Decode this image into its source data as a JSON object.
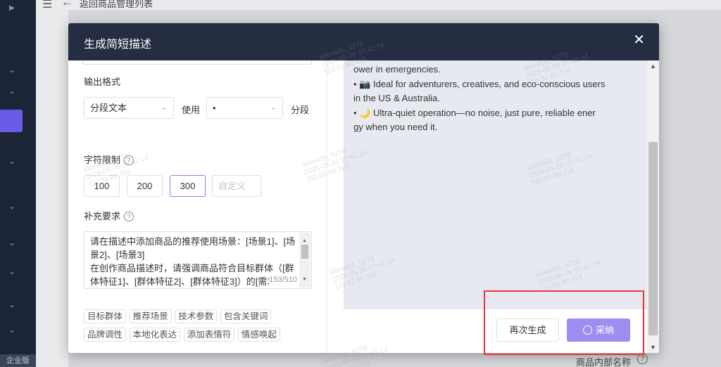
{
  "background": {
    "back_label": "返回商品管理列表",
    "edition_label": "企业版",
    "right_field_label": "商品内部名称",
    "help_glyph": "?"
  },
  "modal": {
    "title": "生成简短描述",
    "close_glyph": "✕"
  },
  "form": {
    "output_format": {
      "label": "输出格式",
      "format_select_value": "分段文本",
      "use_text": "使用",
      "separator_select_value": "•",
      "segment_text": "分段"
    },
    "char_limit": {
      "label": "字符限制",
      "options": [
        "100",
        "200",
        "300"
      ],
      "selected": "300",
      "custom_placeholder": "自定义"
    },
    "extra_requirements": {
      "label": "补充要求",
      "lines": [
        "请在描述中添加商品的推荐使用场景：[场景1]、[场",
        "景2]、[场景3]",
        "在创作商品描述时，请强调商品符合目标群体（[群",
        "体特征1]、[群体特征2]、[群体特征3]）的[需求"
      ],
      "counter": "153/510"
    },
    "tags": [
      "目标群体",
      "推荐场景",
      "技术参数",
      "包含关键词",
      "品牌调性",
      "本地化表达",
      "添加表情符",
      "情感唤起"
    ]
  },
  "output": {
    "lines": [
      "ower in emergencies.",
      "• 📷 Ideal for adventurers, creatives, and eco-conscious users",
      "in the US & Australia.",
      "• 🌙 Ultra-quiet operation—no noise, just pure, reliable ener",
      "gy when you need it."
    ]
  },
  "actions": {
    "regenerate_label": "再次生成",
    "adopt_label": "采纳"
  },
  "watermark": {
    "user": "allen456_5278",
    "time": "2025-05-26 07:41:14",
    "ip": "110.81.80.119"
  },
  "colors": {
    "header_bg": "#242d42",
    "accent": "#9d8ff1",
    "highlight": "#e8343a",
    "output_bg": "#e6e9ef"
  }
}
